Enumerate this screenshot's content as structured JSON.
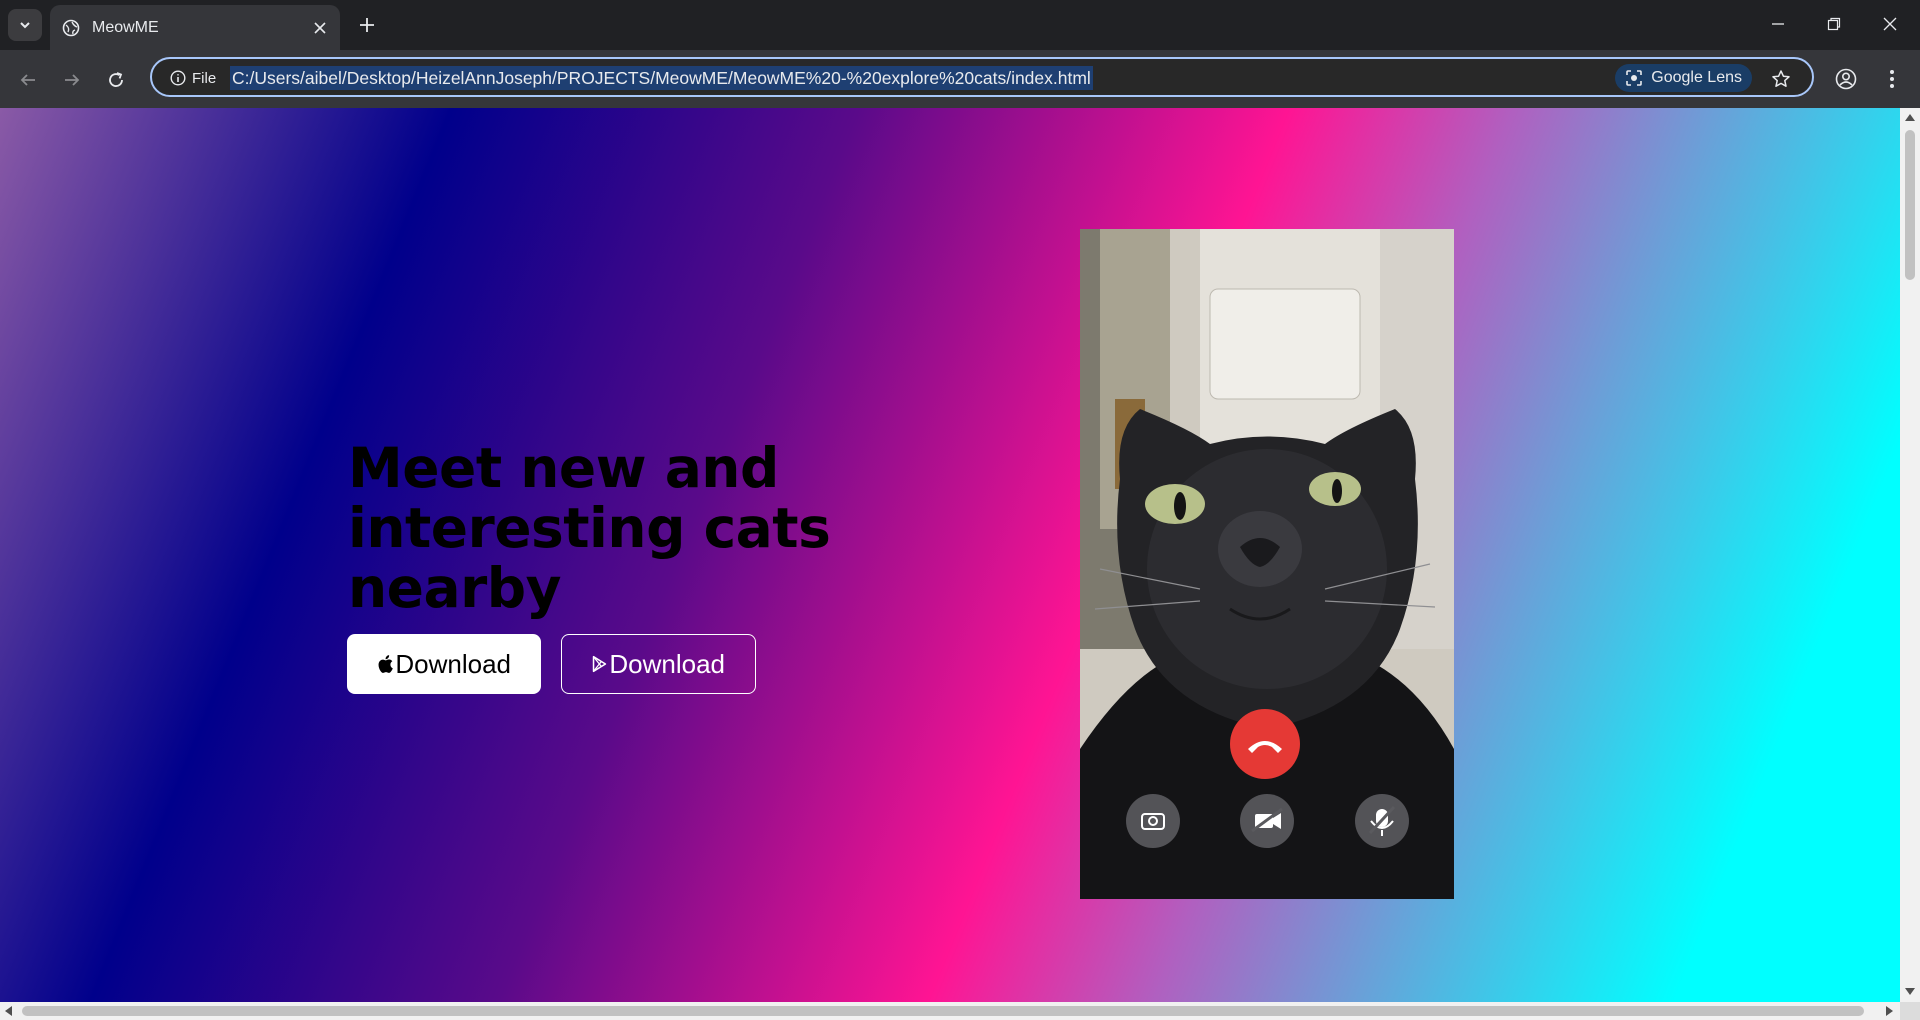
{
  "browser": {
    "tab_title": "MeowME",
    "site_info_label": "File",
    "url": "C:/Users/aibel/Desktop/HeizelAnnJoseph/PROJECTS/MeowME/MeowME%20-%20explore%20cats/index.html",
    "lens_label": "Google Lens"
  },
  "hero": {
    "headline_line1": "Meet new and",
    "headline_line2": "interesting cats",
    "headline_line3": "nearby",
    "apple_button_label": "Download",
    "play_button_label": "Download"
  },
  "icons": {
    "tab_search": "chevron-down-icon",
    "favicon": "globe-icon",
    "close": "close-icon",
    "new_tab": "plus-icon",
    "back": "arrow-left-icon",
    "forward": "arrow-right-icon",
    "reload": "reload-icon",
    "info": "info-icon",
    "lens": "lens-icon",
    "bookmark": "star-icon",
    "profile": "profile-icon",
    "menu": "kebab-menu-icon",
    "apple": "apple-icon",
    "play": "play-store-icon"
  },
  "colors": {
    "chrome_dark": "#202124",
    "toolbar": "#35363a",
    "omnibox_focus": "#a8c7fa",
    "hangup_red": "#e53935",
    "gradient_stops": [
      "#8a5aa6",
      "#00008b",
      "#5a0a8a",
      "#ff1493",
      "#b060c0",
      "#6aa0d8",
      "#00ffff"
    ]
  }
}
